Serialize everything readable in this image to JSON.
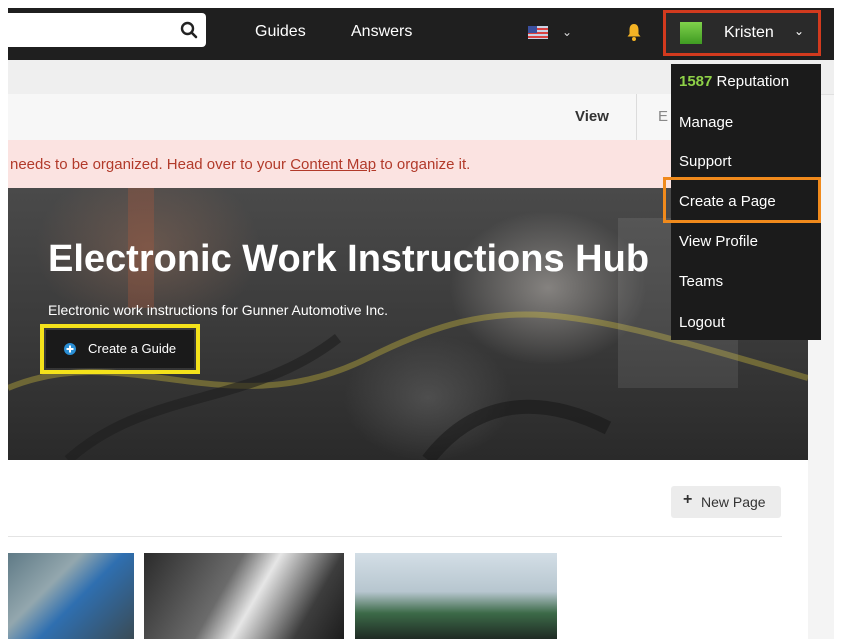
{
  "nav": {
    "links": [
      "Guides",
      "Answers"
    ],
    "user_name": "Kristen"
  },
  "view_tabs": {
    "view": "View",
    "edit_partial": "E"
  },
  "alert": {
    "text_before": "needs to be organized. Head over to your ",
    "link": "Content Map",
    "text_after": " to organize it."
  },
  "hero": {
    "title": "Electronic Work Instructions Hub",
    "subtitle": "Electronic work instructions for Gunner Automotive Inc.",
    "button_label": "Create a Guide"
  },
  "content": {
    "new_page_plus": "+",
    "new_page_label": "New Page"
  },
  "user_menu": {
    "reputation_value": "1587",
    "reputation_label": "Reputation",
    "items": [
      "Manage",
      "Support",
      "Create a Page",
      "View Profile",
      "Teams",
      "Logout"
    ]
  },
  "icons": [
    "search-icon",
    "flag-icon",
    "chevron-down-icon",
    "bell-icon",
    "avatar",
    "plus-circle-icon"
  ],
  "colors": {
    "topbar": "#1f1f1f",
    "user_highlight": "#d23a1e",
    "menu_highlight": "#f08a1c",
    "guide_highlight": "#f4e21b",
    "reputation": "#8ed147",
    "alert_bg": "#fbe3e1",
    "alert_text": "#b23a2a"
  }
}
